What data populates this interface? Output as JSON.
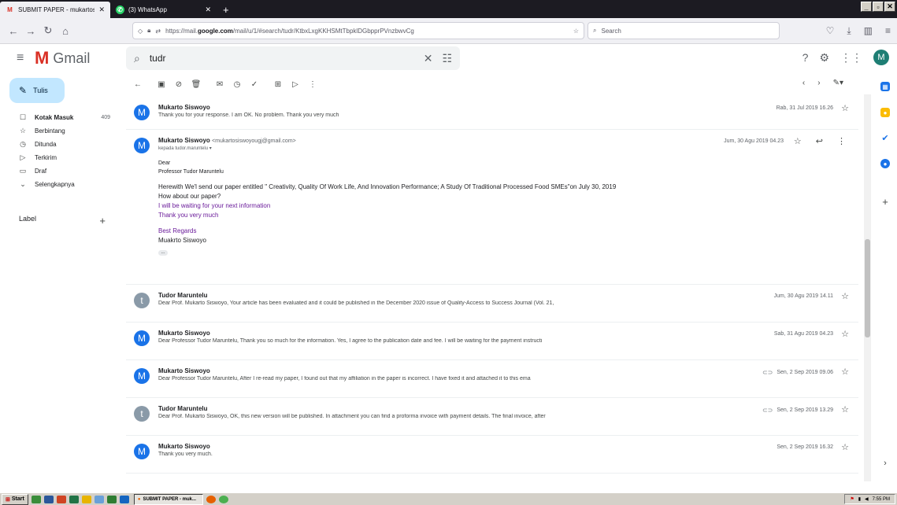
{
  "browser": {
    "tabs": [
      {
        "title": "SUBMIT PAPER - mukartosiswoyou",
        "active": true
      },
      {
        "title": "(3) WhatsApp",
        "active": false
      }
    ],
    "url_prefix": "https://mail.",
    "url_domain": "google.com",
    "url_path": "/mail/u/1/#search/tudr/KtbxLxgKKHSMtTbpklDGbpprPVnzbwvCg",
    "search_placeholder": "Search"
  },
  "gmail": {
    "app_name": "Gmail",
    "search_query": "tudr",
    "avatar_letter": "M",
    "compose_label": "Tulis",
    "nav": [
      {
        "label": "Kotak Masuk",
        "icon": "inbox-icon",
        "count": "409",
        "bold": true
      },
      {
        "label": "Berbintang",
        "icon": "star-icon",
        "count": "",
        "bold": false
      },
      {
        "label": "Ditunda",
        "icon": "clock-icon",
        "count": "",
        "bold": false
      },
      {
        "label": "Terkirim",
        "icon": "send-icon",
        "count": "",
        "bold": false
      },
      {
        "label": "Draf",
        "icon": "file-icon",
        "count": "",
        "bold": false
      },
      {
        "label": "Selengkapnya",
        "icon": "chevron-down-icon",
        "count": "",
        "bold": false
      }
    ],
    "labels_header": "Label"
  },
  "thread": {
    "first": {
      "sender": "Mukarto Siswoyo",
      "snippet": "Thank you for your response. I am OK. No problem. Thank you very much",
      "date": "Rab, 31 Jul 2019 16.26"
    },
    "expanded": {
      "sender": "Mukarto Siswoyo",
      "sender_email": "<mukartosiswoyougj@gmail.com>",
      "to": "kepada tudor.maruntelu",
      "date": "Jum, 30 Agu 2019 04.23",
      "greeting": "Dear",
      "recipient": "Professor Tudor Maruntelu",
      "line1": "Herewith We'l send our paper entitled \" Creativity, Quality Of Work Life, And Innovation Performance; A Study Of Traditional Processed Food SMEs\"on July 30, 2019",
      "line2": "How about our paper?",
      "line3": "I will be waiting for your next information",
      "line4": "Thank you very much",
      "regards": "Best Regards",
      "signature": "Muakrto Siswoyo",
      "more": "..."
    },
    "others": [
      {
        "sender": "Tudor Maruntelu",
        "avatar": "t",
        "color": "gray",
        "snippet": "Dear Prof. Mukarto Siswoyo, Your article has been evaluated and it could be published in the December 2020 issue of Quality-Access to Success Journal (Vol. 21,",
        "date": "Jum, 30 Agu 2019 14.11",
        "attach": false
      },
      {
        "sender": "Mukarto Siswoyo",
        "avatar": "M",
        "color": "blue",
        "snippet": "Dear Professor Tudor Maruntelu, Thank you so much for the information. Yes, I agree to the publication date and fee. I will be waiting for the payment instructi",
        "date": "Sab, 31 Agu 2019 04.23",
        "attach": false
      },
      {
        "sender": "Mukarto Siswoyo",
        "avatar": "M",
        "color": "blue",
        "snippet": "Dear Professor Tudor Maruntelu, After I re-read my paper, I found out that my affiliation in the paper is incorrect. I have fixed it and attached it to this ema",
        "date": "Sen, 2 Sep 2019 09.06",
        "attach": true
      },
      {
        "sender": "Tudor Maruntelu",
        "avatar": "t",
        "color": "gray",
        "snippet": "Dear Prof. Mukarto Siswoyo, OK, this new version will be published. In attachment you can find a proforma invoice with payment details. The final invoice, after",
        "date": "Sen, 2 Sep 2019 13.29",
        "attach": true
      },
      {
        "sender": "Mukarto Siswoyo",
        "avatar": "M",
        "color": "blue",
        "snippet": "Thank you very much.",
        "date": "Sen, 2 Sep 2019 16.32",
        "attach": false
      }
    ]
  },
  "taskbar": {
    "start_label": "Start",
    "task_label": "SUBMIT PAPER - muk...",
    "clock": "7:55 PM"
  },
  "colors": {
    "gmail_red": "#d93025",
    "compose_bg": "#c2e7ff",
    "avatar_blue": "#1a73e8",
    "avatar_gray": "#8a9aa8"
  }
}
